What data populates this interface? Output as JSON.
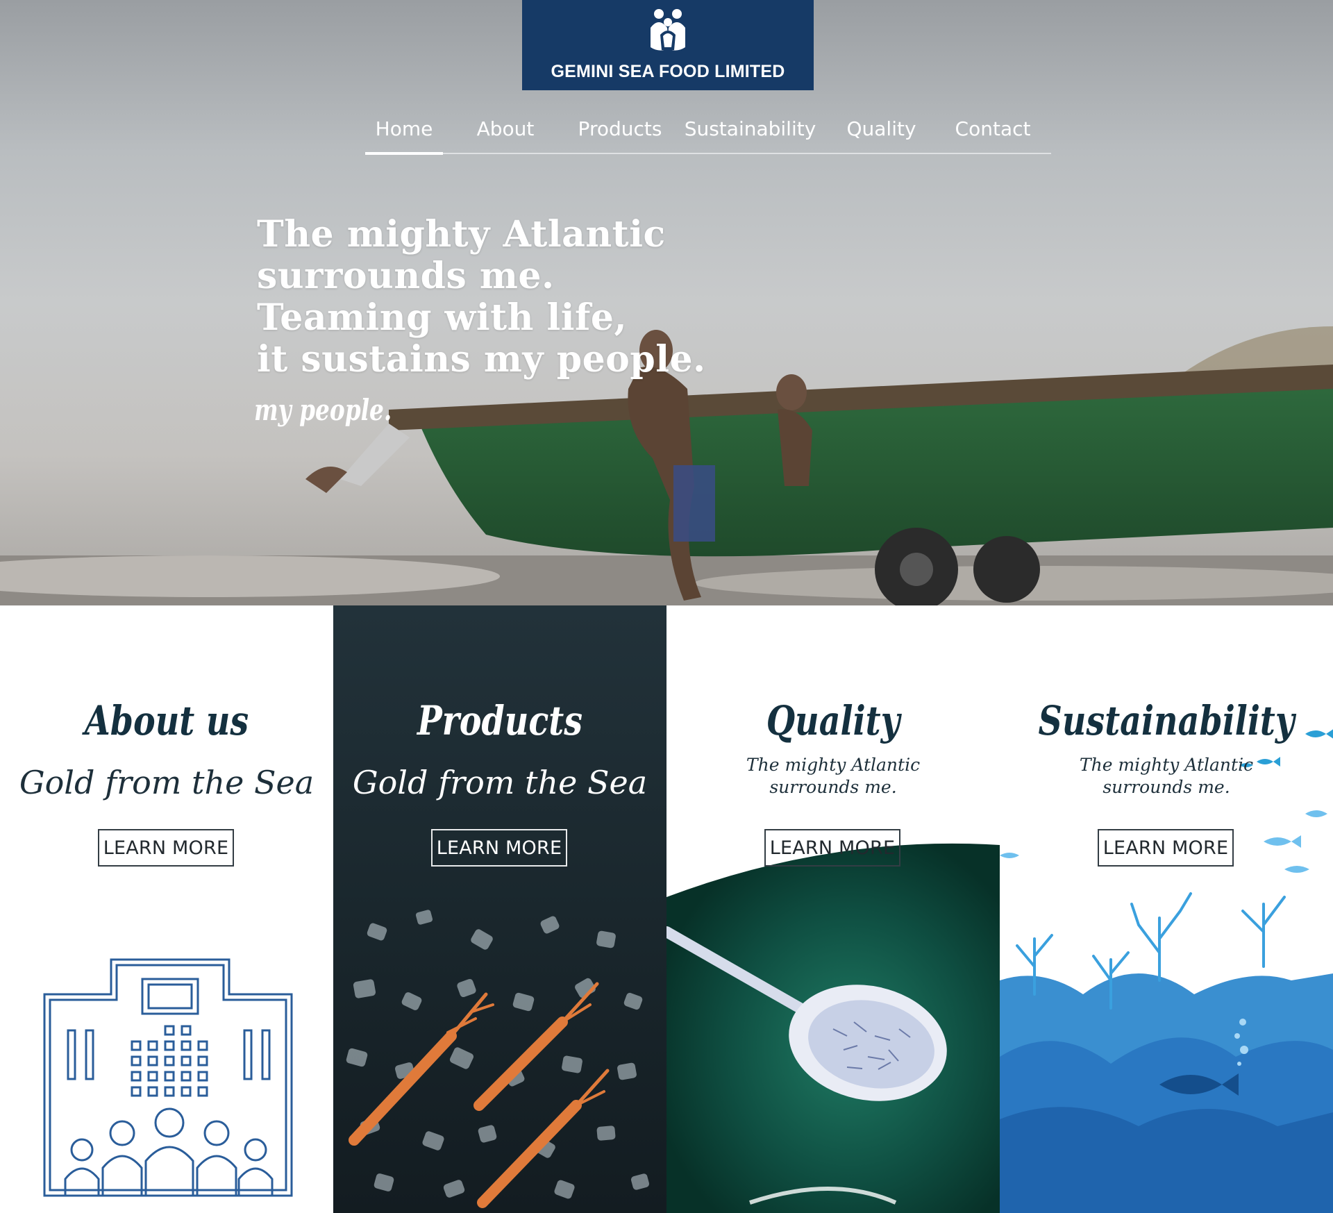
{
  "brand": {
    "name": "GEMINI SEA FOOD LIMITED",
    "logo_icon": "family-emblem-icon",
    "color": "#163a66"
  },
  "nav": {
    "items": [
      {
        "label": "Home",
        "active": true
      },
      {
        "label": "About",
        "active": false
      },
      {
        "label": "Products",
        "active": false
      },
      {
        "label": "Sustainability",
        "active": false
      },
      {
        "label": "Quality",
        "active": false
      },
      {
        "label": "Contact",
        "active": false
      }
    ]
  },
  "hero": {
    "lines": [
      "The mighty Atlantic",
      "surrounds me.",
      "Teaming with life,",
      "it sustains my people."
    ],
    "signature": "my people."
  },
  "panels": [
    {
      "title": "About us",
      "tagline": "Gold from the Sea",
      "button": "LEARN MORE",
      "art": "building-community-icon"
    },
    {
      "title": "Products",
      "tagline": "Gold from the Sea",
      "button": "LEARN MORE",
      "art": "langoustines-on-ice-image"
    },
    {
      "title": "Quality",
      "tagline_lines": [
        "The mighty Atlantic",
        "surrounds me."
      ],
      "button": "LEARN MORE",
      "art": "spoon-with-fry-image"
    },
    {
      "title": "Sustainability",
      "tagline_lines": [
        "The mighty Atlantic",
        "surrounds me."
      ],
      "button": "LEARN MORE",
      "art": "coral-reef-illustration"
    }
  ],
  "colors": {
    "heading": "#14303f",
    "ocean_blue": "#1e73b8",
    "products_bg": "#1a272d"
  }
}
